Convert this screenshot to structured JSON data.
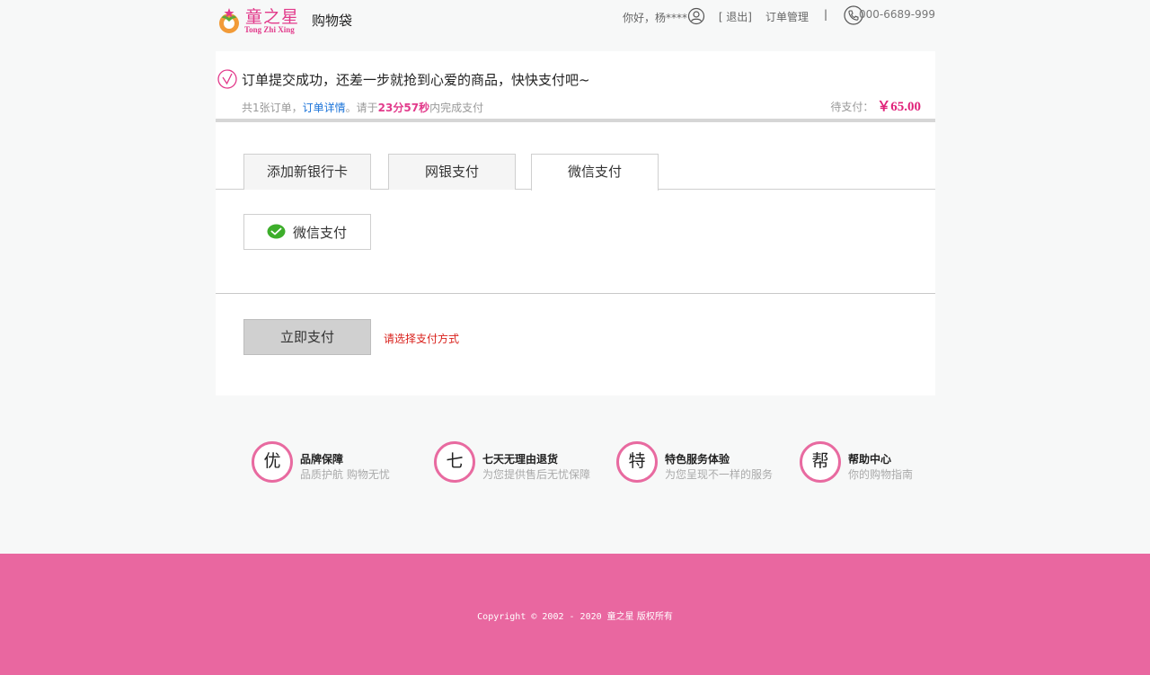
{
  "header": {
    "logo_cn": "童之星",
    "logo_en": "Tong Zhi Xing",
    "page_name": "购物袋",
    "greeting": "你好，杨****",
    "logout": "[ 退出]",
    "orders": "订单管理",
    "separator": "|",
    "phone": "000-6689-999"
  },
  "order": {
    "success_title": "订单提交成功，还差一步就抢到心爱的商品，快快支付吧~",
    "count_text": "共1张订单，",
    "detail_link": "订单详情",
    "deadline_prefix": "。请于",
    "deadline_time": "23分57秒",
    "deadline_suffix": "内完成支付",
    "due_label": "待支付：",
    "due_amount": "￥65.00"
  },
  "payment": {
    "tabs": [
      {
        "label": "添加新银行卡"
      },
      {
        "label": "网银支付"
      },
      {
        "label": "微信支付"
      }
    ],
    "active_tab": 2,
    "method_label": "微信支付",
    "pay_button": "立即支付",
    "hint": "请选择支付方式"
  },
  "services": [
    {
      "badge": "优",
      "title": "品牌保障",
      "subtitle": "品质护航 购物无忧"
    },
    {
      "badge": "七",
      "title": "七天无理由退货",
      "subtitle": "为您提供售后无忧保障"
    },
    {
      "badge": "特",
      "title": "特色服务体验",
      "subtitle": "为您呈现不一样的服务"
    },
    {
      "badge": "帮",
      "title": "帮助中心",
      "subtitle": "你的购物指南"
    }
  ],
  "footer": {
    "copyright": "Copyright © 2002 - 2020 ",
    "copyright_cn": "童之星 版权所有"
  },
  "colors": {
    "brand_pink": "#e967a0",
    "price_pink": "#e0237a",
    "link_blue": "#1a73d9",
    "hint_red": "#d9201b"
  }
}
